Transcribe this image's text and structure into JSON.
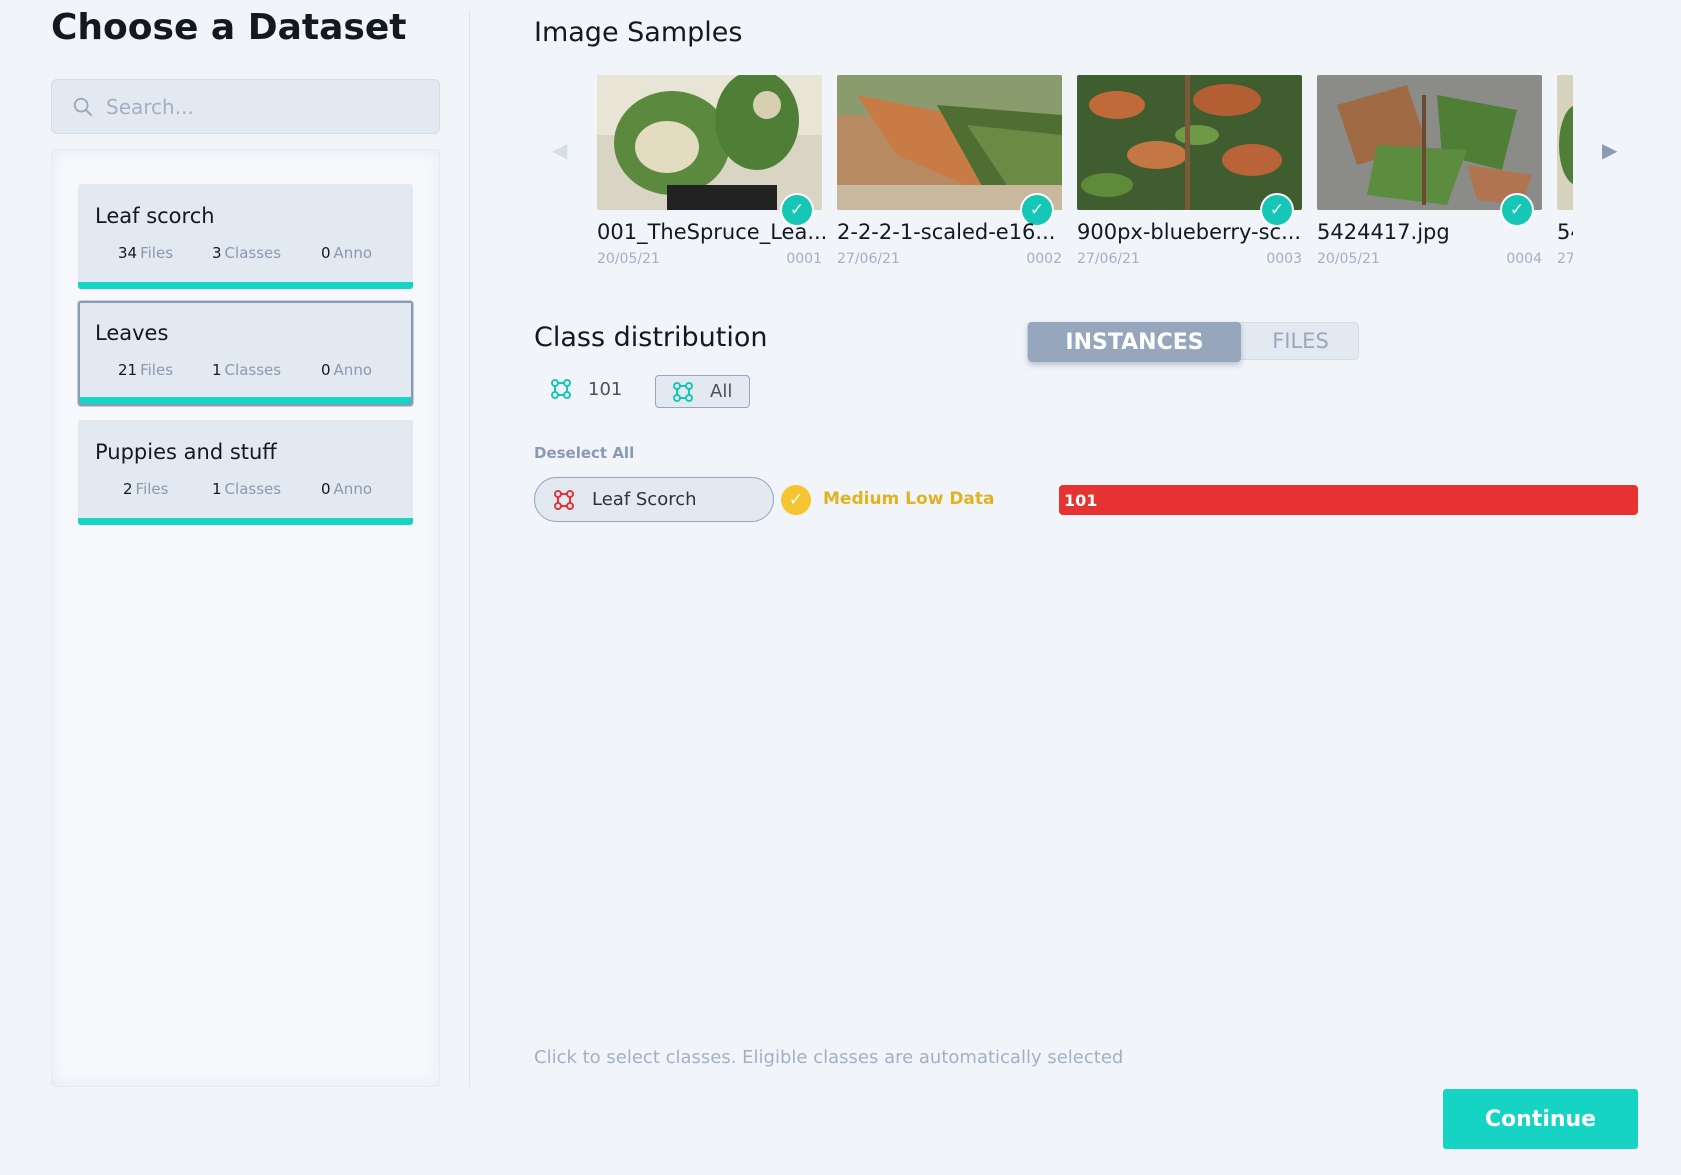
{
  "sidebar": {
    "title": "Choose a Dataset",
    "search_placeholder": "Search...",
    "datasets": [
      {
        "name": "Leaf scorch",
        "files": "34",
        "files_label": "Files",
        "classes": "3",
        "classes_label": "Classes",
        "anno": "0",
        "anno_label": "Anno",
        "selected": false
      },
      {
        "name": "Leaves",
        "files": "21",
        "files_label": "Files",
        "classes": "1",
        "classes_label": "Classes",
        "anno": "0",
        "anno_label": "Anno",
        "selected": true
      },
      {
        "name": "Puppies and stuff",
        "files": "2",
        "files_label": "Files",
        "classes": "1",
        "classes_label": "Classes",
        "anno": "0",
        "anno_label": "Anno",
        "selected": false
      }
    ]
  },
  "samples": {
    "title": "Image Samples",
    "items": [
      {
        "name": "001_TheSpruce_Lea...",
        "date": "20/05/21",
        "id": "0001"
      },
      {
        "name": "2-2-2-1-scaled-e16...",
        "date": "27/06/21",
        "id": "0002"
      },
      {
        "name": "900px-blueberry-sc...",
        "date": "27/06/21",
        "id": "0003"
      },
      {
        "name": "5424417.jpg",
        "date": "20/05/21",
        "id": "0004"
      },
      {
        "name": "54",
        "date": "27",
        "id": ""
      }
    ]
  },
  "distribution": {
    "title": "Class distribution",
    "toggle": {
      "active": "INSTANCES",
      "inactive": "FILES"
    },
    "total_count": "101",
    "all_label": "All",
    "deselect_label": "Deselect All",
    "classes": [
      {
        "name": "Leaf Scorch",
        "status": "Medium Low Data",
        "value": "101",
        "fraction": 1.0
      }
    ],
    "hint": "Click to select classes. Eligible classes are automatically selected"
  },
  "actions": {
    "continue_label": "Continue"
  },
  "colors": {
    "accent": "#16d4c4",
    "bar_red": "#e63232",
    "status_yellow": "#f5c431",
    "muted": "#8a9ab2"
  }
}
